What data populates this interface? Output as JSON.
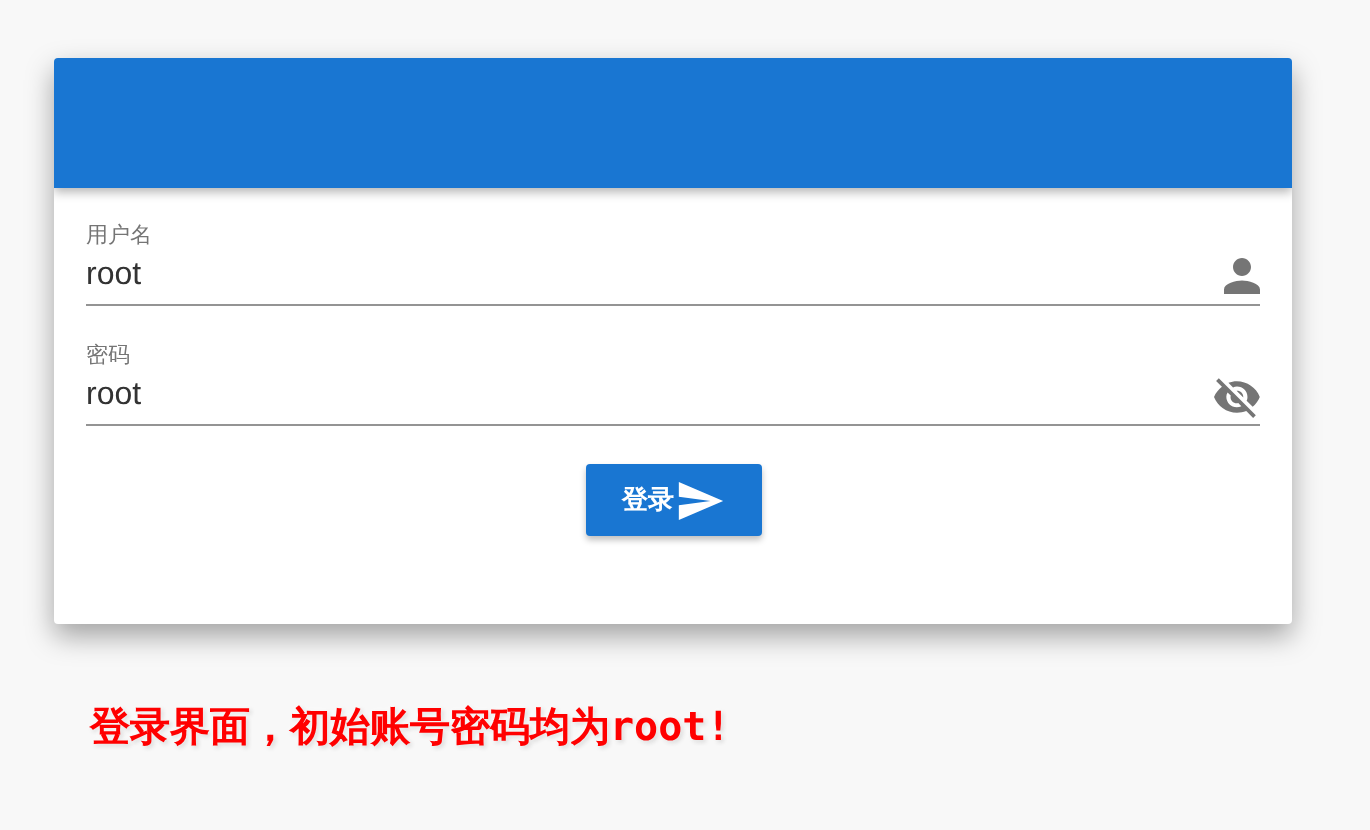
{
  "login_card": {
    "fields": [
      {
        "kind": "user",
        "label": "用户名",
        "value": "root"
      },
      {
        "kind": "password",
        "label": "密码",
        "value": "root"
      }
    ],
    "submit_button": {
      "label": "登录"
    }
  },
  "caption": "登录界面，初始账号密码均为root!"
}
